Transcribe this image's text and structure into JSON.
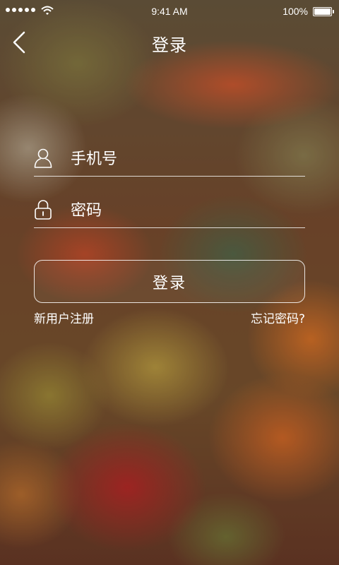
{
  "status_bar": {
    "time": "9:41 AM",
    "battery": "100%"
  },
  "nav": {
    "title": "登录",
    "back_icon": "chevron-left-icon"
  },
  "form": {
    "phone": {
      "placeholder": "手机号",
      "value": "",
      "icon": "user-icon"
    },
    "password": {
      "placeholder": "密码",
      "value": "",
      "icon": "lock-icon"
    },
    "login_label": "登录"
  },
  "links": {
    "register": "新用户注册",
    "forgot": "忘记密码?"
  },
  "colors": {
    "text": "#ffffff",
    "line": "#ffffff"
  }
}
